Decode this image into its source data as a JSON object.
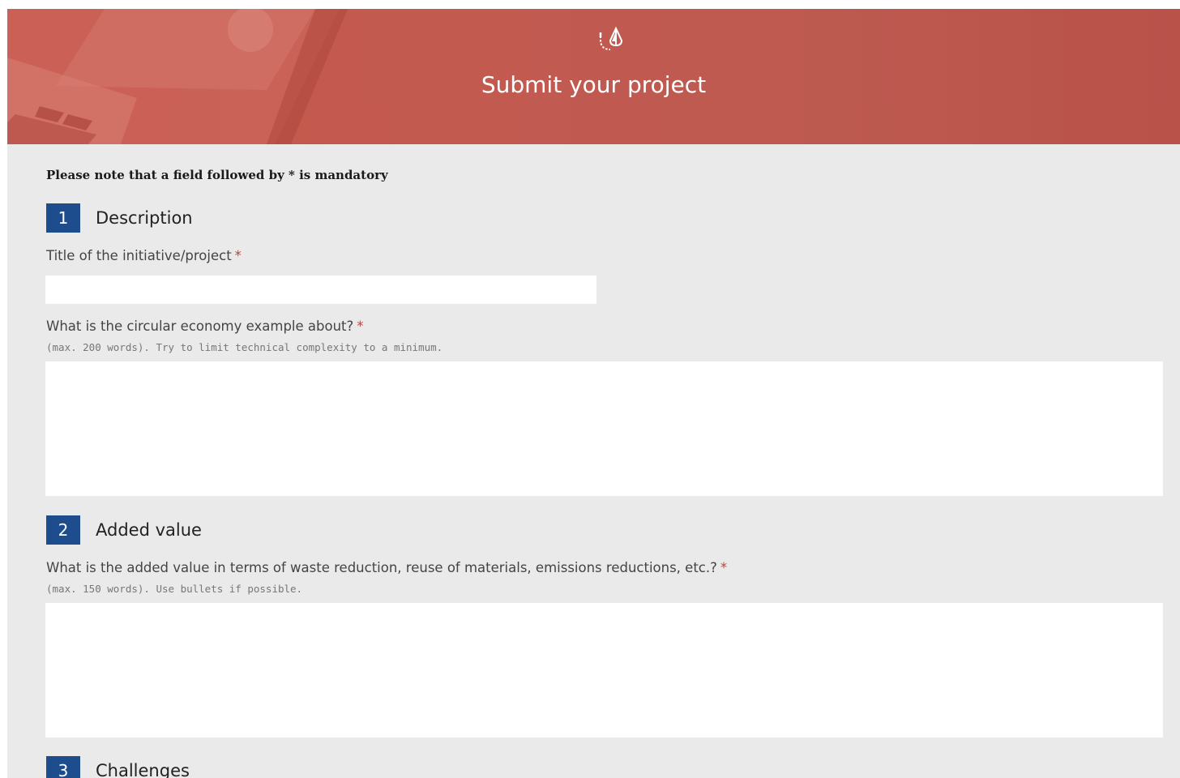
{
  "header": {
    "icon": "circular-drop-logo-icon",
    "title": "Submit your project",
    "background_color": "#c25a50"
  },
  "form": {
    "mandatory_note": "Please note that a field followed by * is mandatory",
    "required_marker": "*",
    "accent_color": "#1d4d8c",
    "sections": [
      {
        "number": "1",
        "title": "Description",
        "fields": [
          {
            "label": "Title of the initiative/project",
            "hint": "",
            "value": "",
            "type": "text"
          },
          {
            "label": "What is the circular economy example about?",
            "hint": "(max. 200 words). Try to limit technical complexity to a minimum.",
            "value": "",
            "type": "textarea"
          }
        ]
      },
      {
        "number": "2",
        "title": "Added value",
        "fields": [
          {
            "label": "What is the added value in terms of waste reduction, reuse of materials, emissions reductions, etc.?",
            "hint": "(max. 150 words). Use bullets if possible.",
            "value": "",
            "type": "textarea"
          }
        ]
      },
      {
        "number": "3",
        "title": "Challenges"
      }
    ]
  }
}
